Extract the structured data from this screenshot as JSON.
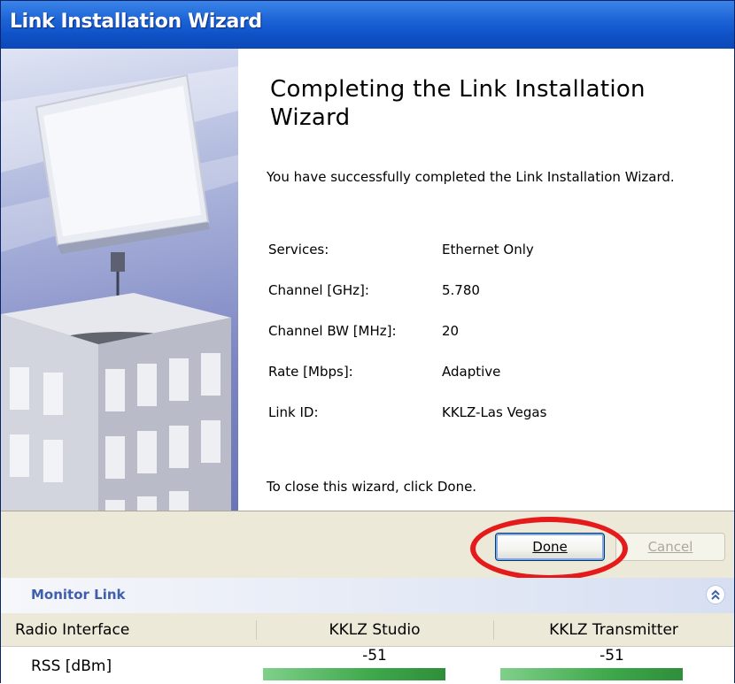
{
  "window": {
    "title": "Link Installation Wizard"
  },
  "wizard": {
    "heading": "Completing the Link Installation Wizard",
    "intro": "You have successfully completed the Link Installation Wizard.",
    "summary": [
      {
        "label": "Services:",
        "value": "Ethernet Only"
      },
      {
        "label": "Channel [GHz]:",
        "value": "5.780"
      },
      {
        "label": "Channel BW [MHz]:",
        "value": "20"
      },
      {
        "label": "Rate [Mbps]:",
        "value": "Adaptive"
      },
      {
        "label": "Link ID:",
        "value": "KKLZ-Las Vegas"
      }
    ],
    "closing": "To close this wizard, click Done."
  },
  "buttons": {
    "done": "Done",
    "cancel": "Cancel"
  },
  "monitor": {
    "title": "Monitor Link",
    "columns": [
      "Radio Interface",
      "KKLZ Studio",
      "KKLZ Transmitter"
    ],
    "rows": [
      {
        "label": "RSS [dBm]",
        "studio": "-51",
        "transmitter": "-51"
      }
    ]
  },
  "colors": {
    "title_bar": "#0f52c8",
    "highlight": "#e51b1b",
    "rss_bar": "#3ea84a",
    "monitor_title": "#3f5fae"
  }
}
